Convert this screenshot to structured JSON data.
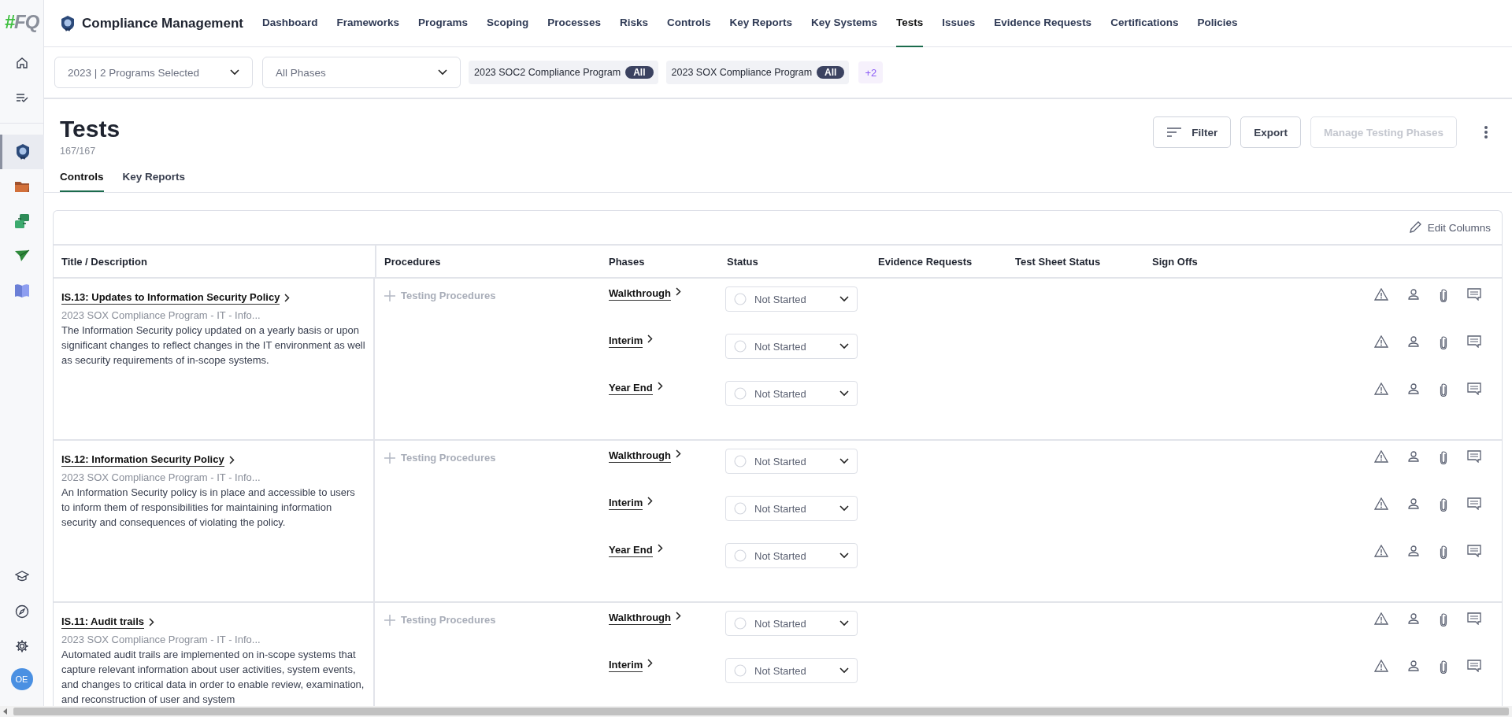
{
  "sidebar": {
    "logo_hash": "#",
    "logo_letters": "FQ",
    "top": [
      {
        "kind": "home",
        "selected": false
      },
      {
        "kind": "tasks",
        "selected": false
      }
    ],
    "apps": [
      {
        "kind": "shield",
        "selected": true
      },
      {
        "kind": "folder",
        "selected": false
      },
      {
        "kind": "cards",
        "selected": false
      },
      {
        "kind": "plane",
        "selected": false
      },
      {
        "kind": "book",
        "selected": false
      }
    ],
    "bottom": [
      {
        "kind": "cap"
      },
      {
        "kind": "compass"
      },
      {
        "kind": "gear"
      }
    ],
    "avatar": "OE"
  },
  "app": {
    "title": "Compliance Management"
  },
  "nav_tabs": [
    {
      "label": "Dashboard",
      "selected": false
    },
    {
      "label": "Frameworks",
      "selected": false
    },
    {
      "label": "Programs",
      "selected": false
    },
    {
      "label": "Scoping",
      "selected": false
    },
    {
      "label": "Processes",
      "selected": false
    },
    {
      "label": "Risks",
      "selected": false
    },
    {
      "label": "Controls",
      "selected": false
    },
    {
      "label": "Key Reports",
      "selected": false
    },
    {
      "label": "Key Systems",
      "selected": false
    },
    {
      "label": "Tests",
      "selected": true
    },
    {
      "label": "Issues",
      "selected": false
    },
    {
      "label": "Evidence Requests",
      "selected": false
    },
    {
      "label": "Certifications",
      "selected": false
    },
    {
      "label": "Policies",
      "selected": false
    }
  ],
  "filters": {
    "year_select": "2023 | 2 Programs Selected",
    "phase_select": "All Phases",
    "chips": [
      {
        "label": "2023 SOC2 Compliance Program",
        "badge": "All"
      },
      {
        "label": "2023 SOX Compliance Program",
        "badge": "All"
      }
    ],
    "more": "+2"
  },
  "page": {
    "title": "Tests",
    "count": "167/167",
    "buttons": [
      {
        "label": "Filter",
        "kind": "filter",
        "disabled": false
      },
      {
        "label": "Export",
        "kind": "plain",
        "disabled": false
      },
      {
        "label": "Manage Testing Phases",
        "kind": "plain",
        "disabled": true
      }
    ]
  },
  "view_tabs": [
    {
      "label": "Controls",
      "selected": true
    },
    {
      "label": "Key Reports",
      "selected": false
    }
  ],
  "table": {
    "edit_columns": "Edit Columns",
    "columns": [
      "Title / Description",
      "Procedures",
      "Phases",
      "Status",
      "Evidence Requests",
      "Test Sheet Status",
      "Sign Offs"
    ],
    "rows": [
      {
        "title": "IS.13: Updates to Information Security Policy",
        "program": "2023 SOX Compliance Program - IT - Info...",
        "description": "The Information Security policy updated on a yearly basis or upon significant changes to reflect changes in the IT environment as well as security requirements of in-scope systems.",
        "procedures": "Testing Procedures",
        "phases": [
          {
            "name": "Walkthrough",
            "status": "Not Started"
          },
          {
            "name": "Interim",
            "status": "Not Started"
          },
          {
            "name": "Year End",
            "status": "Not Started"
          }
        ]
      },
      {
        "title": "IS.12: Information Security Policy",
        "program": "2023 SOX Compliance Program - IT - Info...",
        "description": "An Information Security policy is in place and accessible to users to inform them of responsibilities for maintaining information security and consequences of violating the policy.",
        "procedures": "Testing Procedures",
        "phases": [
          {
            "name": "Walkthrough",
            "status": "Not Started"
          },
          {
            "name": "Interim",
            "status": "Not Started"
          },
          {
            "name": "Year End",
            "status": "Not Started"
          }
        ]
      },
      {
        "title": "IS.11: Audit trails",
        "program": "2023 SOX Compliance Program - IT - Info...",
        "description": "Automated audit trails are implemented on in-scope systems that capture relevant information about user activities, system events, and changes to critical data in order to enable review, examination, and reconstruction of user and system",
        "procedures": "Testing Procedures",
        "phases": [
          {
            "name": "Walkthrough",
            "status": "Not Started"
          },
          {
            "name": "Interim",
            "status": "Not Started"
          }
        ]
      }
    ]
  }
}
